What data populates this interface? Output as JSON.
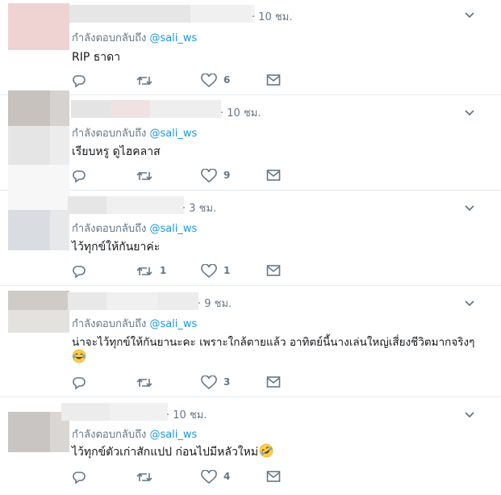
{
  "replies": [
    {
      "time": "· 10 ชม.",
      "reply_prefix": "กำลังตอบกลับถึง",
      "handle": "@sali_ws",
      "text": "RIP ธาดา",
      "retweets": "",
      "likes": "6",
      "has_emoji": false
    },
    {
      "time": "· 10 ชม.",
      "reply_prefix": "กำลังตอบกลับถึง",
      "handle": "@sali_ws",
      "text": "เรียบหรู ดูไฮคลาส",
      "retweets": "",
      "likes": "9",
      "has_emoji": false
    },
    {
      "time": "· 3 ชม.",
      "reply_prefix": "กำลังตอบกลับถึง",
      "handle": "@sali_ws",
      "text": "ไว้ทุกข์ให้กันยาค่ะ",
      "retweets": "1",
      "likes": "1",
      "has_emoji": false
    },
    {
      "time": "· 9 ชม.",
      "reply_prefix": "กำลังตอบกลับถึง",
      "handle": "@sali_ws",
      "text": "น่าจะไว้ทุกข์ให้กันยานะคะ เพราะใกล้ตายแล้ว อาทิตย์นี้นางเล่นใหญ่เสี่ยงชีวิตมากจริงๆ",
      "retweets": "",
      "likes": "3",
      "has_emoji": true,
      "emoji": "joy-emoji"
    },
    {
      "time": "· 10 ชม.",
      "reply_prefix": "กำลังตอบกลับถึง",
      "handle": "@sali_ws",
      "text": "ไว้ทุกข์ตัวเก่าสักแปป ก่อนไปมีหลัวใหม่",
      "retweets": "",
      "likes": "4",
      "has_emoji": true,
      "emoji": "rofl-emoji"
    }
  ],
  "icons": {
    "reply": "reply-icon",
    "retweet": "retweet-icon",
    "like": "heart-icon",
    "dm": "mail-icon",
    "menu": "chevron-down-icon"
  },
  "colors": {
    "link": "#1b95e0",
    "muted": "#657786",
    "divider": "#e6ecf0",
    "icon": "#657786"
  }
}
